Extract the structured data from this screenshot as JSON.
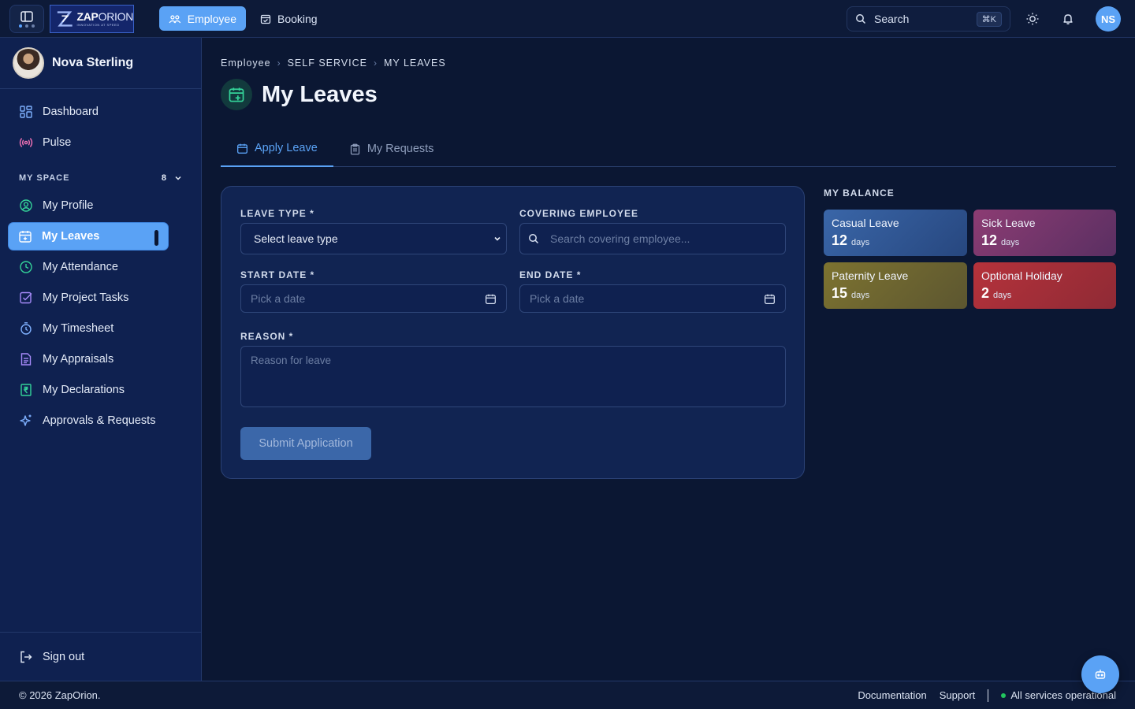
{
  "topbar": {
    "logo_name_bold": "ZAP",
    "logo_name_rest": "ORION",
    "logo_tagline": "INNOVATION AT SPEED",
    "nav": [
      {
        "label": "Employee",
        "icon": "users-icon",
        "active": true
      },
      {
        "label": "Booking",
        "icon": "calendar-check-icon",
        "active": false
      }
    ],
    "search_label": "Search",
    "search_shortcut": "⌘K",
    "avatar_initials": "NS",
    "accent": "#5aa2f5"
  },
  "sidebar": {
    "user_name": "Nova Sterling",
    "top_items": [
      {
        "label": "Dashboard",
        "icon": "grid-icon"
      },
      {
        "label": "Pulse",
        "icon": "broadcast-icon"
      }
    ],
    "section_label": "MY SPACE",
    "section_count": "8",
    "items": [
      {
        "label": "My Profile",
        "icon": "user-circle-icon"
      },
      {
        "label": "My Leaves",
        "icon": "calendar-plus-icon",
        "active": true
      },
      {
        "label": "My Attendance",
        "icon": "clock-icon"
      },
      {
        "label": "My Project Tasks",
        "icon": "checkbox-icon"
      },
      {
        "label": "My Timesheet",
        "icon": "timer-icon"
      },
      {
        "label": "My Appraisals",
        "icon": "document-icon"
      },
      {
        "label": "My Declarations",
        "icon": "rupee-document-icon"
      },
      {
        "label": "Approvals & Requests",
        "icon": "sparkle-icon"
      }
    ],
    "signout_label": "Sign out"
  },
  "breadcrumb": [
    "Employee",
    "SELF SERVICE",
    "MY LEAVES"
  ],
  "page": {
    "title": "My Leaves",
    "tabs": [
      {
        "label": "Apply Leave",
        "active": true
      },
      {
        "label": "My Requests",
        "active": false
      }
    ]
  },
  "form": {
    "leave_type_label": "LEAVE TYPE *",
    "leave_type_value": "Select leave type",
    "covering_label": "COVERING EMPLOYEE",
    "covering_placeholder": "Search covering employee...",
    "start_label": "START DATE *",
    "start_placeholder": "Pick a date",
    "end_label": "END DATE *",
    "end_placeholder": "Pick a date",
    "reason_label": "REASON *",
    "reason_placeholder": "Reason for leave",
    "submit_label": "Submit Application"
  },
  "balance": {
    "label": "MY BALANCE",
    "items": [
      {
        "name": "Casual Leave",
        "value": "12",
        "unit": "days",
        "color": "#2e5595"
      },
      {
        "name": "Sick Leave",
        "value": "12",
        "unit": "days",
        "color": "#7a3a6a"
      },
      {
        "name": "Paternity Leave",
        "value": "15",
        "unit": "days",
        "color": "#706a2e"
      },
      {
        "name": "Optional Holiday",
        "value": "2",
        "unit": "days",
        "color": "#a8303a"
      }
    ]
  },
  "footer": {
    "copyright": "© 2026 ZapOrion.",
    "documentation": "Documentation",
    "support": "Support",
    "status": "All services operational"
  }
}
